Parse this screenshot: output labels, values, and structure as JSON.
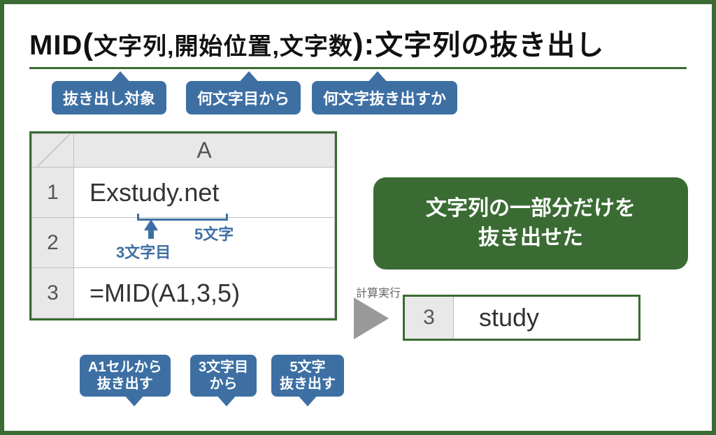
{
  "title": {
    "func": "MID",
    "arg1": "文字列",
    "arg2": "開始位置",
    "arg3": "文字数",
    "desc": "文字列の抜き出し"
  },
  "callouts_top": {
    "c1": "抜き出し対象",
    "c2": "何文字目から",
    "c3": "何文字抜き出すか"
  },
  "sheet": {
    "col": "A",
    "rows": [
      "1",
      "2",
      "3"
    ],
    "a1": "Exstudy.net",
    "a2": "",
    "a3": "=MID(A1,3,5)"
  },
  "annot": {
    "five": "5文字",
    "three": "3文字目"
  },
  "callouts_bottom": {
    "c1": "A1セルから\n抜き出す",
    "c2": "3文字目\nから",
    "c3": "5文字\n抜き出す"
  },
  "exec_label": "計算実行",
  "result": {
    "row": "3",
    "value": "study"
  },
  "summary": "文字列の一部分だけを\n抜き出せた"
}
